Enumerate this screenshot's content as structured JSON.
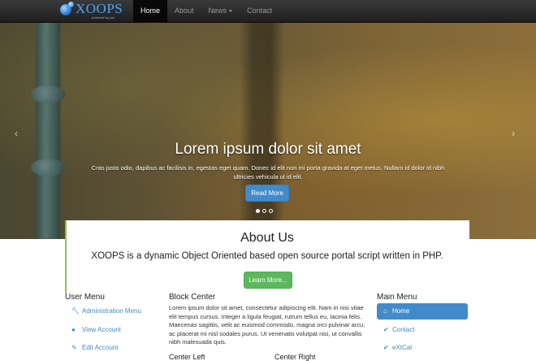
{
  "brand": {
    "name": "XOOPS",
    "tagline": "powered by you"
  },
  "nav": {
    "items": [
      {
        "label": "Home",
        "active": true
      },
      {
        "label": "About",
        "active": false
      },
      {
        "label": "News",
        "active": false,
        "dropdown": true
      },
      {
        "label": "Contact",
        "active": false
      }
    ]
  },
  "carousel": {
    "title": "Lorem ipsum dolor sit amet",
    "text": "Cras justo odio, dapibus ac facilisis in, egestas eget quam. Donec id elit non mi porta gravida at eget metus. Nullam id dolor id nibh ultricies vehicula ut id elit.",
    "button": "Read More",
    "prev_icon": "chevron-left-icon",
    "next_icon": "chevron-right-icon",
    "slides_total": 3,
    "active_slide": 1
  },
  "about": {
    "title": "About Us",
    "lead": "XOOPS is a dynamic Object Oriented based open source portal script written in PHP.",
    "button": "Learn More..."
  },
  "user_menu": {
    "title": "User Menu",
    "items": [
      {
        "label": "Administration Menu",
        "icon": "wrench-icon"
      },
      {
        "label": "View Account",
        "icon": "user-icon"
      },
      {
        "label": "Edit Account",
        "icon": "pencil-icon"
      }
    ]
  },
  "block_center": {
    "title": "Block Center",
    "text": "Lorem ipsum dolor sit amet, consectetur adipiscing elit. Nam in nisi vitae elit tempus cursus. Integer a ligula feugiat, rutrum tellus eu, lacinia felis. Maecenas sagittis, velit ac euismod commodo, magna orci pulvinar arcu; ac placerat mi nisl sodales purus. Ut venenatis volutpat nisi, ut convallis nibh malesuada quis.",
    "sub_left": "Center Left",
    "sub_right": "Center Right"
  },
  "main_menu": {
    "title": "Main Menu",
    "items": [
      {
        "label": "Home",
        "icon": "home-icon",
        "active": true
      },
      {
        "label": "Contact",
        "icon": "check-icon",
        "active": false
      },
      {
        "label": "eXtCal",
        "icon": "check-icon",
        "active": false
      }
    ]
  },
  "colors": {
    "primary": "#428bca",
    "success": "#5cb85c",
    "navbar": "#222222",
    "accent_border": "#8cc152"
  }
}
